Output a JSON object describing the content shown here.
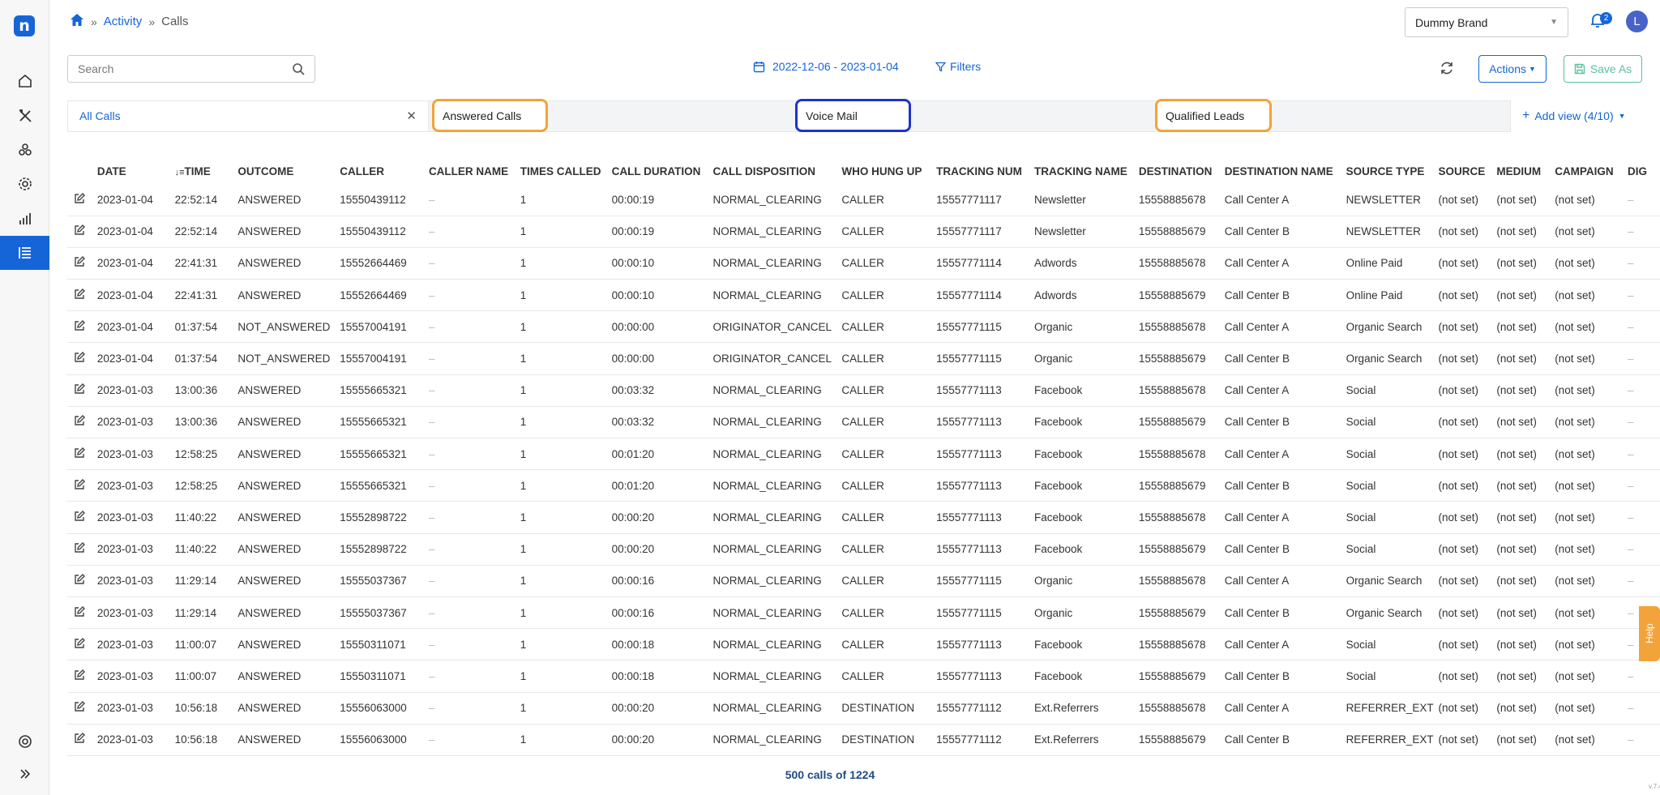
{
  "breadcrumb": {
    "home_icon": "home-icon",
    "activity": "Activity",
    "calls": "Calls"
  },
  "header": {
    "brand": "Dummy Brand",
    "notifications": "2",
    "avatar_letter": "L"
  },
  "toolbar": {
    "search_placeholder": "Search",
    "date_range": "2022-12-06 - 2023-01-04",
    "filters": "Filters",
    "actions": "Actions",
    "save_as": "Save As"
  },
  "views": {
    "all_calls": "All Calls",
    "answered_calls": "Answered Calls",
    "voice_mail": "Voice Mail",
    "qualified_leads": "Qualified Leads",
    "add_view": "Add view (4/10)"
  },
  "table": {
    "columns": [
      "DATE",
      "TIME",
      "OUTCOME",
      "CALLER",
      "CALLER NAME",
      "TIMES CALLED",
      "CALL DURATION",
      "CALL DISPOSITION",
      "WHO HUNG UP",
      "TRACKING NUM",
      "TRACKING NAME",
      "DESTINATION",
      "DESTINATION NAME",
      "SOURCE TYPE",
      "SOURCE",
      "MEDIUM",
      "CAMPAIGN",
      "DIG"
    ],
    "rows": [
      [
        "2023-01-04",
        "22:52:14",
        "ANSWERED",
        "15550439112",
        "–",
        "1",
        "00:00:19",
        "NORMAL_CLEARING",
        "CALLER",
        "15557771117",
        "Newsletter",
        "15558885678",
        "Call Center A",
        "NEWSLETTER",
        "(not set)",
        "(not set)",
        "(not set)",
        "–"
      ],
      [
        "2023-01-04",
        "22:52:14",
        "ANSWERED",
        "15550439112",
        "–",
        "1",
        "00:00:19",
        "NORMAL_CLEARING",
        "CALLER",
        "15557771117",
        "Newsletter",
        "15558885679",
        "Call Center B",
        "NEWSLETTER",
        "(not set)",
        "(not set)",
        "(not set)",
        "–"
      ],
      [
        "2023-01-04",
        "22:41:31",
        "ANSWERED",
        "15552664469",
        "–",
        "1",
        "00:00:10",
        "NORMAL_CLEARING",
        "CALLER",
        "15557771114",
        "Adwords",
        "15558885678",
        "Call Center A",
        "Online Paid",
        "(not set)",
        "(not set)",
        "(not set)",
        "–"
      ],
      [
        "2023-01-04",
        "22:41:31",
        "ANSWERED",
        "15552664469",
        "–",
        "1",
        "00:00:10",
        "NORMAL_CLEARING",
        "CALLER",
        "15557771114",
        "Adwords",
        "15558885679",
        "Call Center B",
        "Online Paid",
        "(not set)",
        "(not set)",
        "(not set)",
        "–"
      ],
      [
        "2023-01-04",
        "01:37:54",
        "NOT_ANSWERED",
        "15557004191",
        "–",
        "1",
        "00:00:00",
        "ORIGINATOR_CANCEL",
        "CALLER",
        "15557771115",
        "Organic",
        "15558885678",
        "Call Center A",
        "Organic Search",
        "(not set)",
        "(not set)",
        "(not set)",
        "–"
      ],
      [
        "2023-01-04",
        "01:37:54",
        "NOT_ANSWERED",
        "15557004191",
        "–",
        "1",
        "00:00:00",
        "ORIGINATOR_CANCEL",
        "CALLER",
        "15557771115",
        "Organic",
        "15558885679",
        "Call Center B",
        "Organic Search",
        "(not set)",
        "(not set)",
        "(not set)",
        "–"
      ],
      [
        "2023-01-03",
        "13:00:36",
        "ANSWERED",
        "15555665321",
        "–",
        "1",
        "00:03:32",
        "NORMAL_CLEARING",
        "CALLER",
        "15557771113",
        "Facebook",
        "15558885678",
        "Call Center A",
        "Social",
        "(not set)",
        "(not set)",
        "(not set)",
        "–"
      ],
      [
        "2023-01-03",
        "13:00:36",
        "ANSWERED",
        "15555665321",
        "–",
        "1",
        "00:03:32",
        "NORMAL_CLEARING",
        "CALLER",
        "15557771113",
        "Facebook",
        "15558885679",
        "Call Center B",
        "Social",
        "(not set)",
        "(not set)",
        "(not set)",
        "–"
      ],
      [
        "2023-01-03",
        "12:58:25",
        "ANSWERED",
        "15555665321",
        "–",
        "1",
        "00:01:20",
        "NORMAL_CLEARING",
        "CALLER",
        "15557771113",
        "Facebook",
        "15558885678",
        "Call Center A",
        "Social",
        "(not set)",
        "(not set)",
        "(not set)",
        "–"
      ],
      [
        "2023-01-03",
        "12:58:25",
        "ANSWERED",
        "15555665321",
        "–",
        "1",
        "00:01:20",
        "NORMAL_CLEARING",
        "CALLER",
        "15557771113",
        "Facebook",
        "15558885679",
        "Call Center B",
        "Social",
        "(not set)",
        "(not set)",
        "(not set)",
        "–"
      ],
      [
        "2023-01-03",
        "11:40:22",
        "ANSWERED",
        "15552898722",
        "–",
        "1",
        "00:00:20",
        "NORMAL_CLEARING",
        "CALLER",
        "15557771113",
        "Facebook",
        "15558885678",
        "Call Center A",
        "Social",
        "(not set)",
        "(not set)",
        "(not set)",
        "–"
      ],
      [
        "2023-01-03",
        "11:40:22",
        "ANSWERED",
        "15552898722",
        "–",
        "1",
        "00:00:20",
        "NORMAL_CLEARING",
        "CALLER",
        "15557771113",
        "Facebook",
        "15558885679",
        "Call Center B",
        "Social",
        "(not set)",
        "(not set)",
        "(not set)",
        "–"
      ],
      [
        "2023-01-03",
        "11:29:14",
        "ANSWERED",
        "15555037367",
        "–",
        "1",
        "00:00:16",
        "NORMAL_CLEARING",
        "CALLER",
        "15557771115",
        "Organic",
        "15558885678",
        "Call Center A",
        "Organic Search",
        "(not set)",
        "(not set)",
        "(not set)",
        "–"
      ],
      [
        "2023-01-03",
        "11:29:14",
        "ANSWERED",
        "15555037367",
        "–",
        "1",
        "00:00:16",
        "NORMAL_CLEARING",
        "CALLER",
        "15557771115",
        "Organic",
        "15558885679",
        "Call Center B",
        "Organic Search",
        "(not set)",
        "(not set)",
        "(not set)",
        "–"
      ],
      [
        "2023-01-03",
        "11:00:07",
        "ANSWERED",
        "15550311071",
        "–",
        "1",
        "00:00:18",
        "NORMAL_CLEARING",
        "CALLER",
        "15557771113",
        "Facebook",
        "15558885678",
        "Call Center A",
        "Social",
        "(not set)",
        "(not set)",
        "(not set)",
        "–"
      ],
      [
        "2023-01-03",
        "11:00:07",
        "ANSWERED",
        "15550311071",
        "–",
        "1",
        "00:00:18",
        "NORMAL_CLEARING",
        "CALLER",
        "15557771113",
        "Facebook",
        "15558885679",
        "Call Center B",
        "Social",
        "(not set)",
        "(not set)",
        "(not set)",
        "–"
      ],
      [
        "2023-01-03",
        "10:56:18",
        "ANSWERED",
        "15556063000",
        "–",
        "1",
        "00:00:20",
        "NORMAL_CLEARING",
        "DESTINATION",
        "15557771112",
        "Ext.Referrers",
        "15558885678",
        "Call Center A",
        "REFERRER_EXT",
        "(not set)",
        "(not set)",
        "(not set)",
        "–"
      ],
      [
        "2023-01-03",
        "10:56:18",
        "ANSWERED",
        "15556063000",
        "–",
        "1",
        "00:00:20",
        "NORMAL_CLEARING",
        "DESTINATION",
        "15557771112",
        "Ext.Referrers",
        "15558885679",
        "Call Center B",
        "REFERRER_EXT",
        "(not set)",
        "(not set)",
        "(not set)",
        "–"
      ]
    ]
  },
  "footer": {
    "count": "500 calls of 1224"
  },
  "help": "Help",
  "version": "v.7.4",
  "colors": {
    "primary": "#1565d8",
    "orange_highlight": "#f2a33a",
    "blue_highlight": "#1e34c8",
    "save_green": "#5cc19a"
  }
}
